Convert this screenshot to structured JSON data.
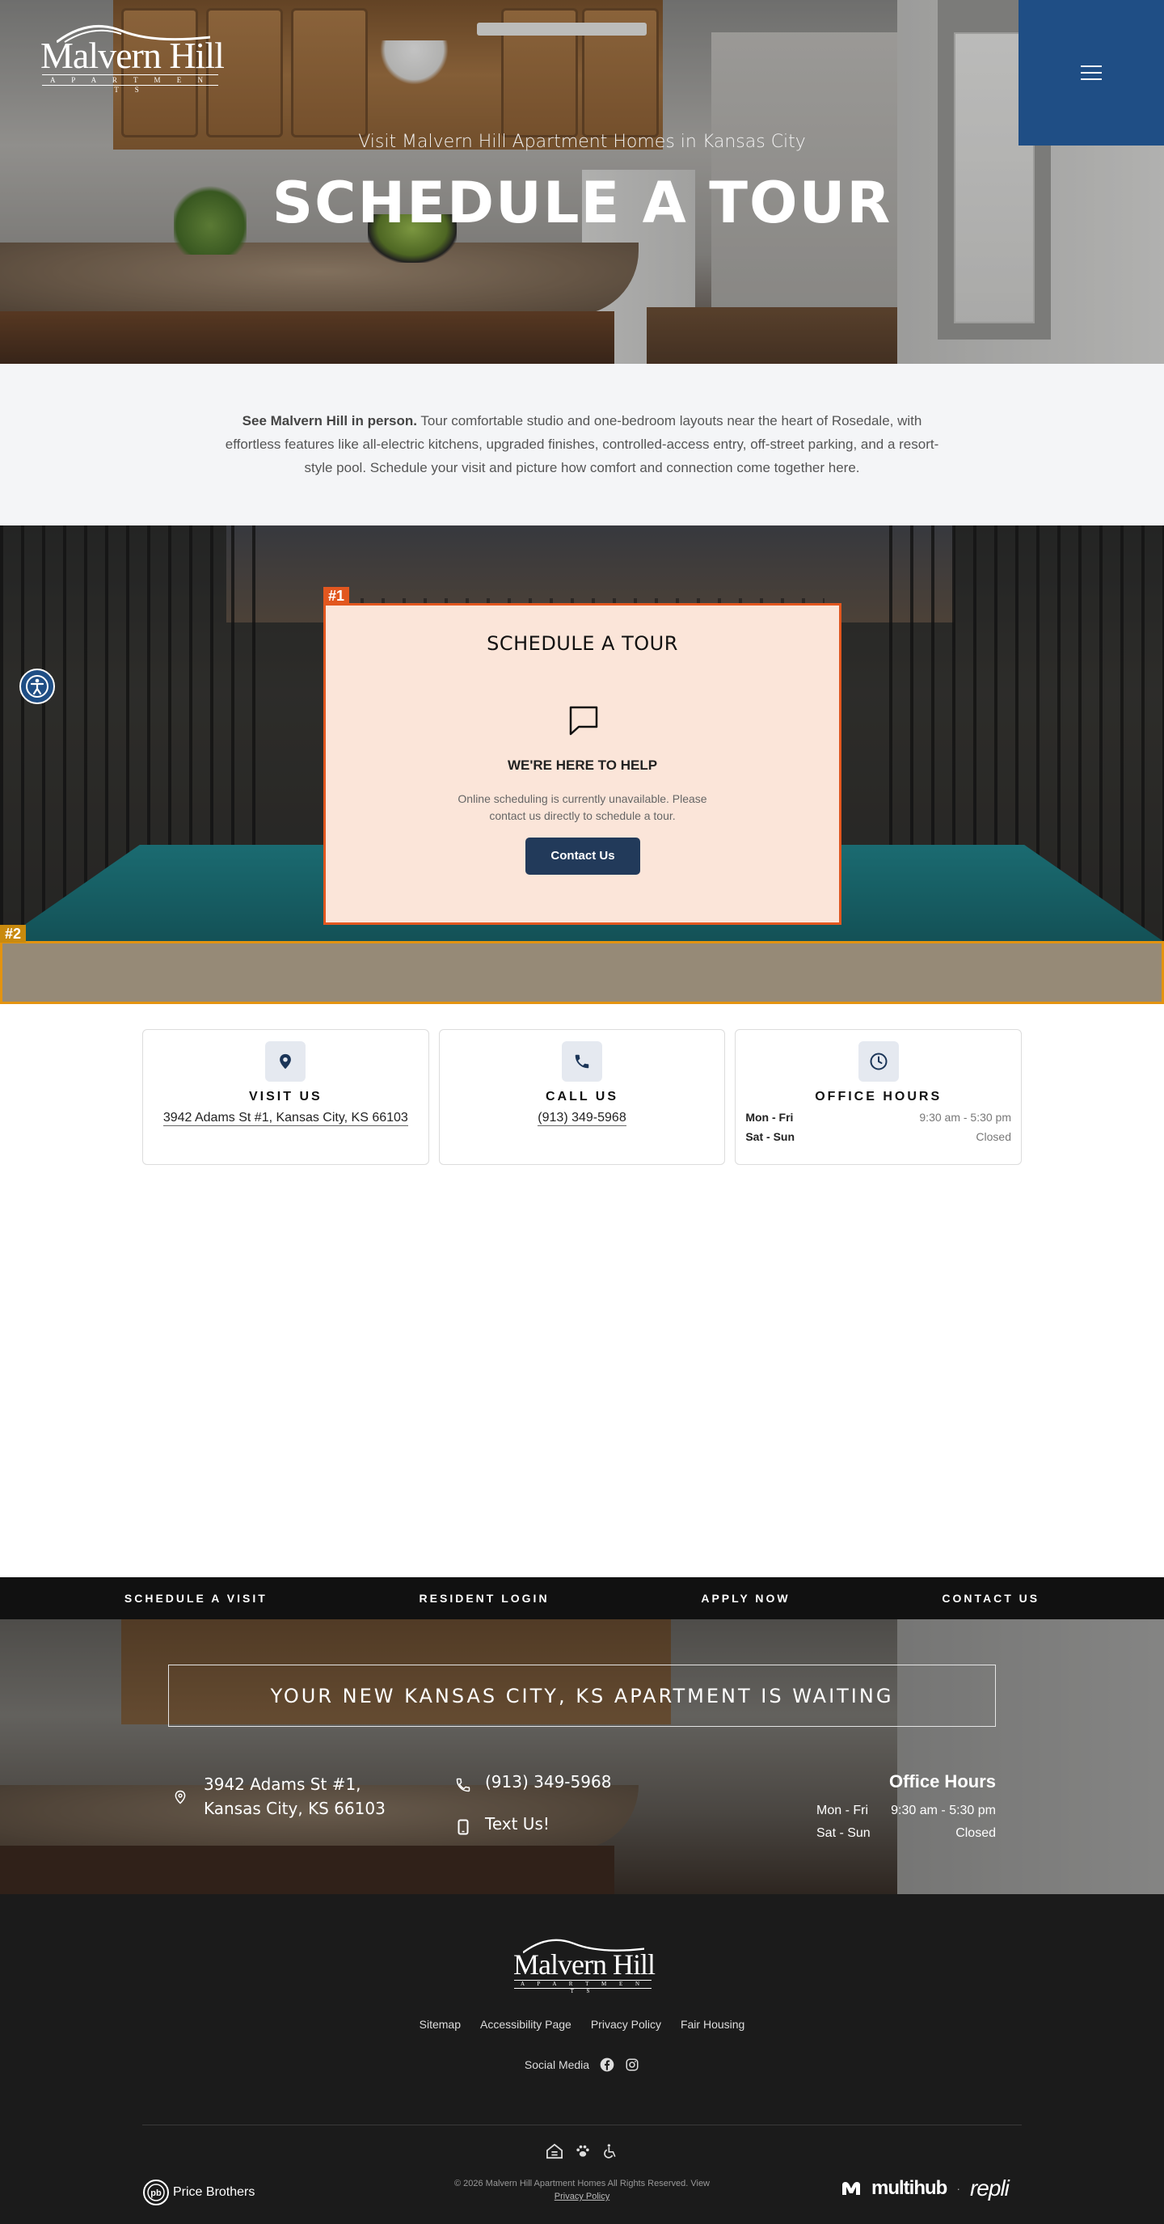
{
  "brand": {
    "name": "Malvern Hill",
    "tagline": "A P A R T M E N T S"
  },
  "hero": {
    "kicker": "Visit Malvern Hill Apartment Homes in Kansas City",
    "title": "SCHEDULE A TOUR"
  },
  "intro": {
    "lead": "See Malvern Hill in person.",
    "body": " Tour comfortable studio and one-bedroom layouts near the heart of Rosedale, with effortless features like all-electric kitchens, upgraded finishes, controlled-access entry, off-street parking, and a resort-style pool. Schedule your visit and picture how comfort and connection come together here."
  },
  "tour_card": {
    "tag": "#1",
    "title": "SCHEDULE A TOUR",
    "heading": "WE'RE HERE TO HELP",
    "message": "Online scheduling is currently unavailable. Please contact us directly to schedule a tour.",
    "button_label": "Contact Us"
  },
  "strip": {
    "tag": "#2"
  },
  "info_cards": {
    "visit": {
      "label": "VISIT US",
      "value": "3942 Adams St #1, Kansas City, KS 66103"
    },
    "call": {
      "label": "CALL US",
      "value": "(913) 349-5968"
    },
    "hours": {
      "label": "OFFICE HOURS",
      "rows": [
        {
          "days": "Mon - Fri",
          "time": "9:30 am - 5:30 pm"
        },
        {
          "days": "Sat - Sun",
          "time": "Closed"
        }
      ]
    }
  },
  "links_bar": [
    "SCHEDULE A VISIT",
    "RESIDENT LOGIN",
    "APPLY NOW",
    "CONTACT US"
  ],
  "contact": {
    "banner": "YOUR NEW KANSAS CITY, KS APARTMENT IS WAITING",
    "address_line1": "3942 Adams St #1,",
    "address_line2": "Kansas City, KS 66103",
    "phone": "(913) 349-5968",
    "text": "Text Us!",
    "hours_title": "Office Hours",
    "hours": [
      {
        "days": "Mon - Fri",
        "time": "9:30 am - 5:30 pm"
      },
      {
        "days": "Sat - Sun",
        "time": "Closed"
      }
    ]
  },
  "footer": {
    "links": [
      "Sitemap",
      "Accessibility Page",
      "Privacy Policy",
      "Fair Housing"
    ],
    "social_label": "Social Media",
    "copyright": "© 2026 Malvern Hill Apartment Homes All Rights Reserved. View",
    "privacy_link": "Privacy Policy",
    "management": "Price Brothers",
    "partner1": "multihub",
    "partner_sep": "·",
    "partner2": "repli"
  },
  "colors": {
    "menu_blue": "#1f4e85",
    "tour_card_bg": "#fbe5d9",
    "tour_card_border": "#e2571f",
    "button_navy": "#223a5a",
    "footer_bg": "#1b1b1b"
  }
}
